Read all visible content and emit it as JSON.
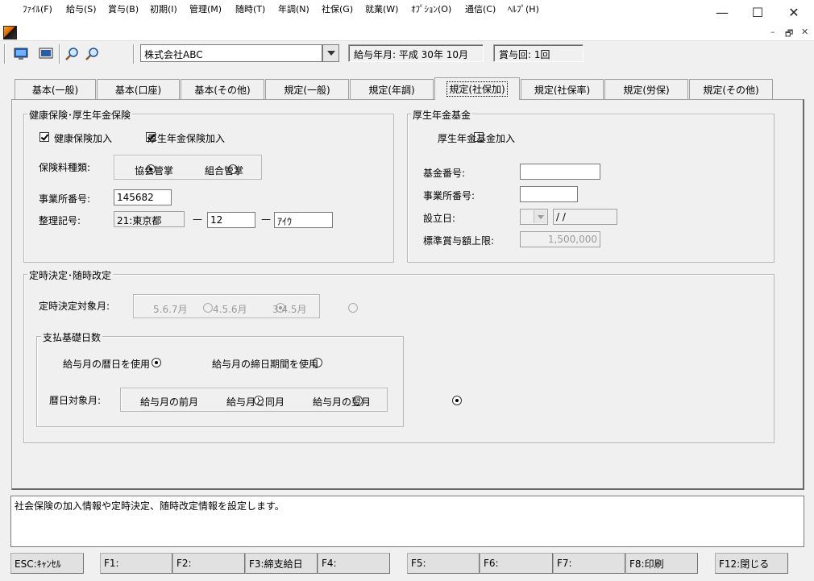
{
  "window": {
    "minimize_glyph": "—",
    "maximize_glyph": "☐",
    "close_glyph": "✕"
  },
  "menu": [
    {
      "label": "ﾌｧｲﾙ(F)"
    },
    {
      "label": "給与(S)"
    },
    {
      "label": "賞与(B)"
    },
    {
      "label": "初期(I)"
    },
    {
      "label": "管理(M)"
    },
    {
      "label": "随時(T)"
    },
    {
      "label": "年調(N)"
    },
    {
      "label": "社保(G)"
    },
    {
      "label": "就業(W)"
    },
    {
      "label": "ｵﾌﾟｼｮﾝ(O)"
    },
    {
      "label": "通信(C)"
    },
    {
      "label": "ﾍﾙﾌﾟ(H)"
    }
  ],
  "mdi": {
    "minimize": "–",
    "restore": "🗗",
    "close": "✕"
  },
  "toolbar": {
    "company": "株式会社ABC",
    "pay_period": "給与年月: 平成 30年 10月",
    "bonus_count": "賞与回: 1回",
    "icons": [
      "monitor-icon",
      "screen-icon",
      "zoom-in-icon",
      "zoom-out-icon"
    ]
  },
  "tabs": [
    {
      "label": "基本(一般)"
    },
    {
      "label": "基本(口座)"
    },
    {
      "label": "基本(その他)"
    },
    {
      "label": "規定(一般)"
    },
    {
      "label": "規定(年調)"
    },
    {
      "label": "規定(社保加)",
      "active": true
    },
    {
      "label": "規定(社保率)"
    },
    {
      "label": "規定(労保)"
    },
    {
      "label": "規定(その他)"
    }
  ],
  "health": {
    "legend": "健康保険･厚生年金保険",
    "health_join": "健康保険加入",
    "pension_join": "厚生年金保険加入",
    "premium_type_label": "保険料種類:",
    "kyokai": "協会管掌",
    "kumiai": "組合管掌",
    "office_no_label": "事業所番号:",
    "office_no": "145682",
    "ref_code_label": "整理記号:",
    "ref_pref": "21:東京都",
    "dash1": "—",
    "ref_code1": "12",
    "dash2": "—",
    "ref_code2": "ｱｲｳ"
  },
  "fund": {
    "legend": "厚生年金基金",
    "join": "厚生年金基金加入",
    "fund_no_label": "基金番号:",
    "fund_no": "",
    "office_no_label": "事業所番号:",
    "office_no": "",
    "est_date_label": "設立日:",
    "est_date": " /  /",
    "bonus_limit_label": "標準賞与額上限:",
    "bonus_limit": "1,500,000"
  },
  "revision": {
    "legend": "定時決定･随時改定",
    "target_label": "定時決定対象月:",
    "opt567": "5.6.7月",
    "opt456": "4.5.6月",
    "opt345": "3.4.5月",
    "basis_legend": "支払基礎日数",
    "use_calendar": "給与月の暦日を使用",
    "use_closing": "給与月の締日期間を使用",
    "calendar_target_label": "暦日対象月:",
    "prev_month": "給与月の前月",
    "same_month": "給与月と同月",
    "next_month": "給与月の翌月"
  },
  "status_text": "社会保険の加入情報や定時決定、随時改定情報を設定します。",
  "fkeys": {
    "esc": "ESC:ｷｬﾝｾﾙ",
    "f1": "F1:",
    "f2": "F2:",
    "f3": "F3:締支給日",
    "f4": "F4:",
    "f5": "F5:",
    "f6": "F6:",
    "f7": "F7:",
    "f8": "F8:印刷",
    "f12": "F12:閉じる"
  }
}
